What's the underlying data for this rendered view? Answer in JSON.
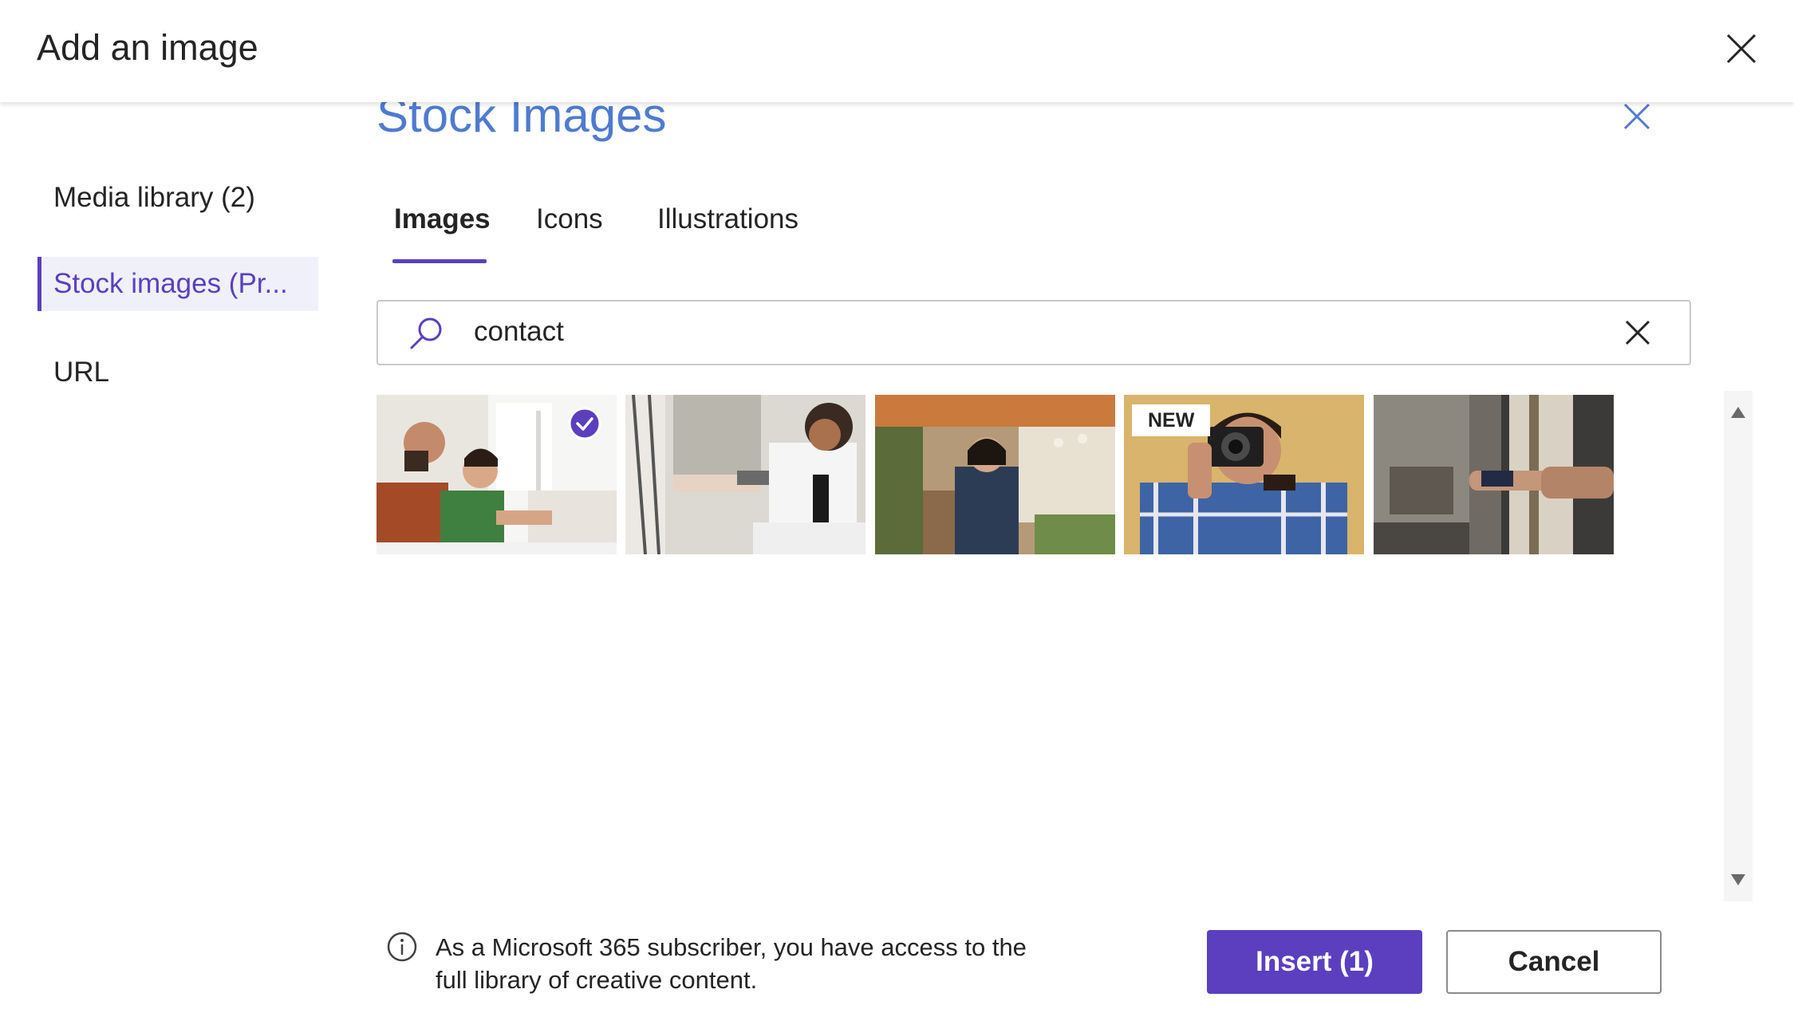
{
  "dialog": {
    "title": "Add an image",
    "close_icon": "close-icon"
  },
  "sidebar": {
    "items": [
      {
        "label": "Media library (2)",
        "active": false
      },
      {
        "label": "Stock images (Pr...",
        "active": true
      },
      {
        "label": "URL",
        "active": false
      }
    ]
  },
  "panel": {
    "title": "Stock Images",
    "tabs": [
      {
        "label": "Images",
        "active": true
      },
      {
        "label": "Icons",
        "active": false
      },
      {
        "label": "Illustrations",
        "active": false
      }
    ],
    "search": {
      "value": "contact",
      "icon": "search-icon",
      "clear_icon": "close-icon"
    },
    "results": [
      {
        "subject": "business handshake in office",
        "selected": true,
        "badge": ""
      },
      {
        "subject": "women exchanging card outdoors",
        "selected": false,
        "badge": ""
      },
      {
        "subject": "woman in plant shop",
        "selected": false,
        "badge": ""
      },
      {
        "subject": "man holding camera",
        "selected": false,
        "badge": "NEW"
      },
      {
        "subject": "card payment at counter",
        "selected": false,
        "badge": ""
      }
    ]
  },
  "footer": {
    "info_text": "As a Microsoft 365 subscriber, you have access to the full library of creative content.",
    "insert_label": "Insert (1)",
    "cancel_label": "Cancel"
  },
  "colors": {
    "accent": "#5b3fbf",
    "title_blue": "#4f7bd0"
  }
}
